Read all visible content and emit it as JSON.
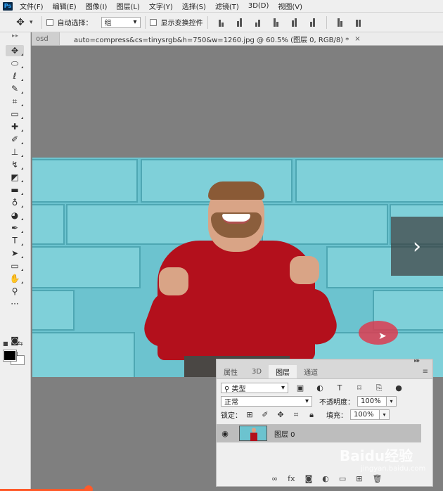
{
  "app": {
    "logo": "Ps"
  },
  "menu": [
    "文件(F)",
    "编辑(E)",
    "图像(I)",
    "图层(L)",
    "文字(Y)",
    "选择(S)",
    "滤镜(T)",
    "3D(D)",
    "视图(V)"
  ],
  "options_bar": {
    "auto_select_label": "自动选择：",
    "auto_select_value": "组",
    "show_transform_label": "显示变换控件"
  },
  "document": {
    "prev_tab": "osd",
    "tab_title": "auto=compress&cs=tinysrgb&h=750&w=1260.jpg @ 60.5% (图层 0, RGB/8) *",
    "close": "×"
  },
  "layers_panel": {
    "tabs": [
      "属性",
      "3D",
      "图层",
      "通道"
    ],
    "active_tab": 2,
    "filter_label": "类型",
    "blend_mode": "正常",
    "opacity_label": "不透明度：",
    "opacity_value": "100%",
    "lock_label": "锁定：",
    "fill_label": "填充：",
    "fill_value": "100%",
    "layer_name": "图层 0"
  },
  "watermark": {
    "text": "Baidu经验",
    "sub": "jingyan.baidu.com"
  },
  "video_progress": 0.2,
  "colors": {
    "accent": "#ff5a2a",
    "canvas_bg": "#7f7f7f",
    "shirt": "#b3101c",
    "wall": "#6cc3cf"
  }
}
